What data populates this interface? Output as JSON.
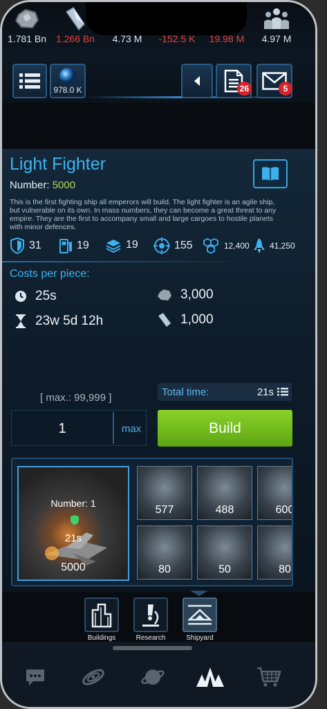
{
  "header": {
    "planet_value": "978.0 K",
    "reports_badge": "26",
    "messages_badge": "5"
  },
  "resources": [
    {
      "icon": "metal-icon",
      "value": "1.781 Bn",
      "color": "#e6edf2"
    },
    {
      "icon": "crystal-icon",
      "value": "1.266 Bn",
      "color": "#e2453c"
    },
    {
      "icon": "deuterium-icon",
      "value": "4.73 M",
      "color": "#e6edf2"
    },
    {
      "icon": "energy-icon",
      "value": "-152.5 K",
      "color": "#e2453c"
    },
    {
      "icon": "food-icon",
      "value": "19.98 M",
      "color": "#e2453c"
    },
    {
      "icon": "population-icon",
      "value": "4.97 M",
      "color": "#e6edf2"
    }
  ],
  "ship": {
    "name": "Light Fighter",
    "number_label": "Number:",
    "number_value": "5000",
    "description": "This is the first fighting ship all emperors will build. The light fighter is an agile ship, but vulnerable on its own. In mass numbers, they can become a great threat to any empire. They are the first to accompany small and large cargoes to hostile planets with minor defences.",
    "stats": {
      "shield": "31",
      "fuel": "19",
      "cargo": "19",
      "weapons": "155",
      "structure": "12,400",
      "speed": "41,250"
    }
  },
  "costs": {
    "title": "Costs per piece:",
    "build_time": "25s",
    "total_duration": "23w 5d 12h",
    "metal": "3,000",
    "crystal": "1,000"
  },
  "build": {
    "max_label": "[ max.: 99,999 ]",
    "total_time_label": "Total time:",
    "total_time_value": "21s",
    "quantity": "1",
    "max_button": "max",
    "build_button": "Build"
  },
  "ship_list": {
    "selected": {
      "number_label": "Number: 1",
      "time": "21s",
      "count": "5000"
    },
    "cards": [
      "577",
      "488",
      "600",
      "80",
      "50",
      "80"
    ]
  },
  "tabs": [
    "Buildings",
    "Research",
    "Shipyard"
  ],
  "nav": [
    "chat-icon",
    "galaxy-icon",
    "planet-icon",
    "fleet-icon",
    "shop-icon"
  ]
}
